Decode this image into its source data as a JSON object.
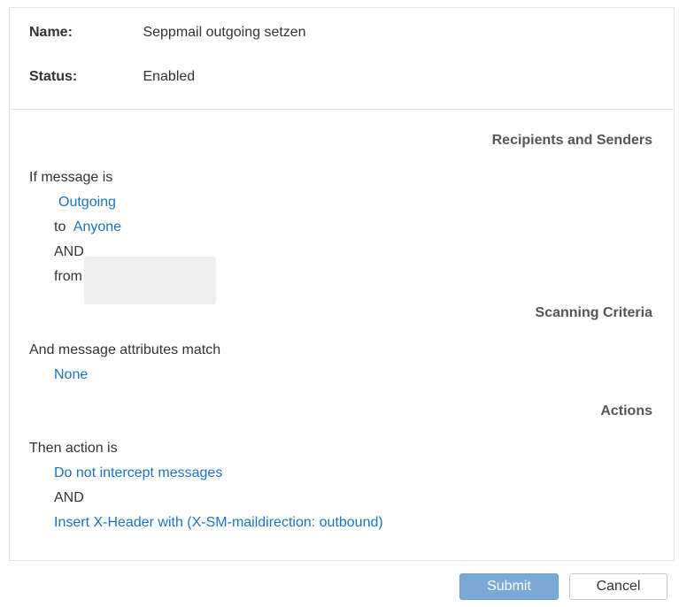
{
  "rule": {
    "name_label": "Name:",
    "name_value": "Seppmail outgoing setzen",
    "status_label": "Status:",
    "status_value": "Enabled"
  },
  "recipients": {
    "section_title": "Recipients and Senders",
    "intro": "If message is",
    "direction": "Outgoing",
    "to_label": "to",
    "to_value": "Anyone",
    "and_label": "AND",
    "from_label": "from"
  },
  "scanning": {
    "section_title": "Scanning Criteria",
    "intro": "And message attributes match",
    "value": "None"
  },
  "actions": {
    "section_title": "Actions",
    "intro": "Then action is",
    "action_1": "Do not intercept messages",
    "and_label": "AND",
    "action_2": "Insert X-Header with (X-SM-maildirection: outbound)"
  },
  "buttons": {
    "submit": "Submit",
    "cancel": "Cancel"
  },
  "colors": {
    "link": "#1a73c0",
    "submit_bg": "#7aa9d6",
    "border": "#e3e3e3"
  }
}
